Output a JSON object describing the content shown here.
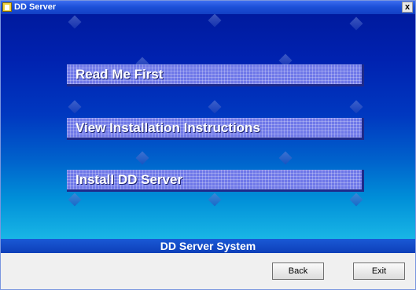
{
  "window": {
    "title": "DD Server",
    "close_label": "x"
  },
  "menu": [
    {
      "label": "Read Me First"
    },
    {
      "label": "View Installation Instructions"
    },
    {
      "label": "Install DD Server"
    }
  ],
  "footer": {
    "label": "DD Server System"
  },
  "buttons": {
    "back_label": "Back",
    "exit_label": "Exit"
  },
  "colors": {
    "accent": "#6f78e8",
    "stage_top": "#001a9e",
    "stage_bottom": "#19b6e6"
  }
}
